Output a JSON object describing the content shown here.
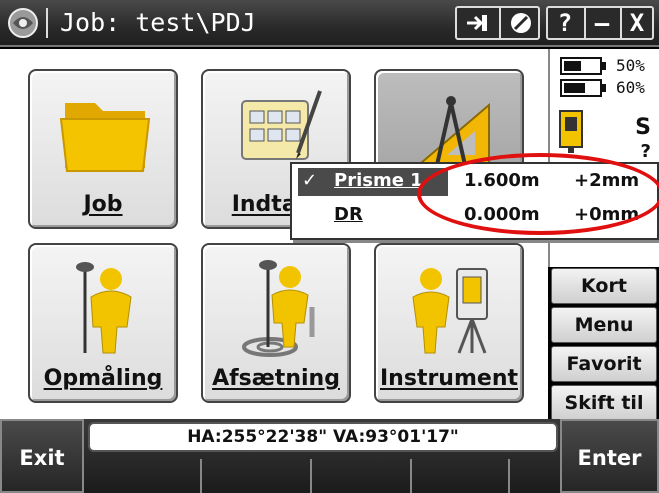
{
  "titlebar": {
    "title": "Job: test\\PDJ",
    "window_buttons": {
      "help": "?",
      "minimize": "—",
      "close": "X"
    }
  },
  "tiles": [
    {
      "id": "job",
      "label": "Job",
      "icon": "folder-icon"
    },
    {
      "id": "survey-tasks",
      "label": "Indtast",
      "icon": "keypad-card-icon"
    },
    {
      "id": "cogo",
      "label": "",
      "icon": "compass-triangle-icon"
    },
    {
      "id": "survey",
      "label": "Opmåling",
      "icon": "surveyor-rover-icon"
    },
    {
      "id": "stakeout",
      "label": "Afsætning",
      "icon": "stakeout-rover-icon"
    },
    {
      "id": "instrument",
      "label": "Instrument",
      "icon": "total-station-icon"
    }
  ],
  "status": {
    "battery_1": "50%",
    "battery_2": "60%",
    "mode": "S",
    "mode_sub": "?"
  },
  "side_menu": [
    "Kort",
    "Menu",
    "Favorit",
    "Skift til"
  ],
  "prism_popup": {
    "rows": [
      {
        "check": "✓",
        "name": "Prisme 1",
        "height": "1.600m",
        "constant": "+2mm",
        "selected": true
      },
      {
        "check": "",
        "name": "DR",
        "height": "0.000m",
        "constant": "+0mm",
        "selected": false
      }
    ]
  },
  "bottom": {
    "exit": "Exit",
    "enter": "Enter",
    "angles": "HA:255°22'38\"  VA:93°01'17\""
  },
  "colors": {
    "titlebar": "#2a2a2a",
    "annotation": "#e01010",
    "folder": "#f5c400"
  }
}
